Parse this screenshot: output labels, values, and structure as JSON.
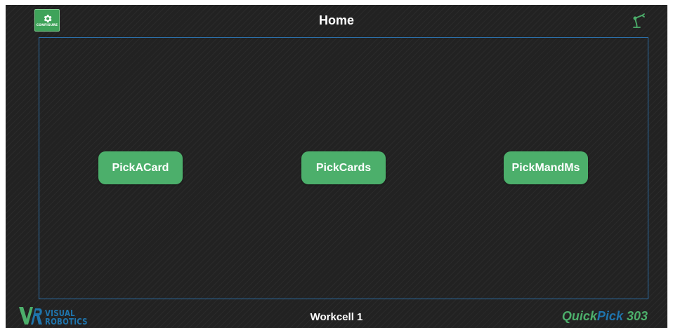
{
  "header": {
    "title": "Home",
    "configure_label": "CONFIGURE",
    "configure_icon": "gear-icon",
    "robot_icon": "robot-arm-icon"
  },
  "main": {
    "jobs": [
      {
        "label": "PickACard"
      },
      {
        "label": "PickCards"
      },
      {
        "label": "PickMandMs"
      }
    ]
  },
  "footer": {
    "workcell": "Workcell 1",
    "logo_line1": "VISUAL",
    "logo_line2": "ROBOTICS",
    "product_part1": "Quick",
    "product_part2": "Pick",
    "product_part3": " 303"
  },
  "colors": {
    "background": "#222222",
    "accent_green": "#4caf6b",
    "brand_blue": "#1f75ad",
    "border_blue": "#2c6fa8"
  }
}
